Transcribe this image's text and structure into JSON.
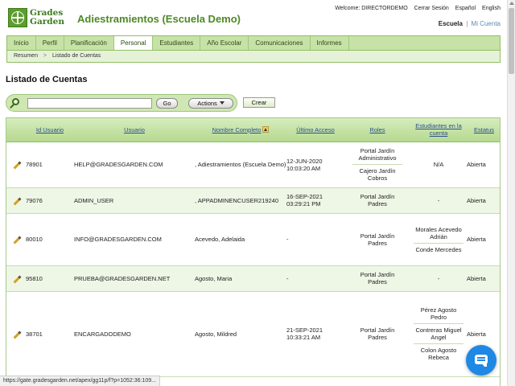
{
  "header": {
    "logo_line1": "Grades",
    "logo_line2": "Garden",
    "title": "Adiestramientos (Escuela Demo)",
    "welcome": "Welcome: DIRECTORDEMO",
    "logout": "Cerrar Sesión",
    "lang_es": "Español",
    "lang_en": "English",
    "school_active": "Escuela",
    "school_sep": "|",
    "school_other": "Mi Cuenta"
  },
  "nav": {
    "tabs": [
      "Inicio",
      "Perfil",
      "Planificación",
      "Personal",
      "Estudiantes",
      "Año Escolar",
      "Comunicaciones",
      "Informes"
    ],
    "active_index": 3
  },
  "breadcrumb": {
    "items": [
      "Resumen",
      "Listado de Cuentas"
    ],
    "separator": ">"
  },
  "page": {
    "title": "Listado de Cuentas"
  },
  "toolbar": {
    "search_value": "",
    "go_label": "Go",
    "actions_label": "Actions",
    "create_label": "Crear"
  },
  "table": {
    "headers": {
      "id": "Id Usuario",
      "user": "Usuario",
      "name": "Nombre Completo",
      "last": "Último Acceso",
      "roles": "Roles",
      "students": "Estudiantes en la cuenta",
      "status": "Estatus"
    },
    "rows": [
      {
        "id": "78901",
        "user": "HELP@GRADESGARDEN.COM",
        "name": ", Adiestramientos (Escuela Demo)",
        "last": "12-JUN-2020 10:03:20 AM",
        "roles": [
          "Portal Jardín Administrativo",
          "Cajero Jardín Cobros"
        ],
        "students": [
          "N/A"
        ],
        "status": "Abierta"
      },
      {
        "id": "79076",
        "user": "ADMIN_USER",
        "name": ", APPADMINENCUSER219240",
        "last": "16-SEP-2021 03:29:21 PM",
        "roles": [
          "Portal Jardín Padres"
        ],
        "students": [
          "-"
        ],
        "status": "Abierta"
      },
      {
        "id": "80010",
        "user": "INFO@GRADESGARDEN.COM",
        "name": "Acevedo, Adelaida",
        "last": "-",
        "roles": [
          "Portal Jardín Padres"
        ],
        "students": [
          "Morales Acevedo Adrián",
          "Conde Mercedes"
        ],
        "status": "Abierta"
      },
      {
        "id": "95810",
        "user": "PRUEBA@GRADESGARDEN.NET",
        "name": "Agosto, Maria",
        "last": "-",
        "roles": [
          "Portal Jardín Padres"
        ],
        "students": [
          "-"
        ],
        "status": "Abierta"
      },
      {
        "id": "38701",
        "user": "ENCARGADODEMO",
        "name": "Agosto, Mildred",
        "last": "21-SEP-2021 10:33:21 AM",
        "roles": [
          "Portal Jardín Padres"
        ],
        "students": [
          "Pérez Agosto Pedro",
          "Contreras Miguel Angel",
          "Colon Agosto Rebeca"
        ],
        "status": "Abierta"
      }
    ]
  },
  "status_bar": {
    "url": "https://gate.gradesgarden.net/apex/gg11p/f?p=1052:36:109..."
  }
}
